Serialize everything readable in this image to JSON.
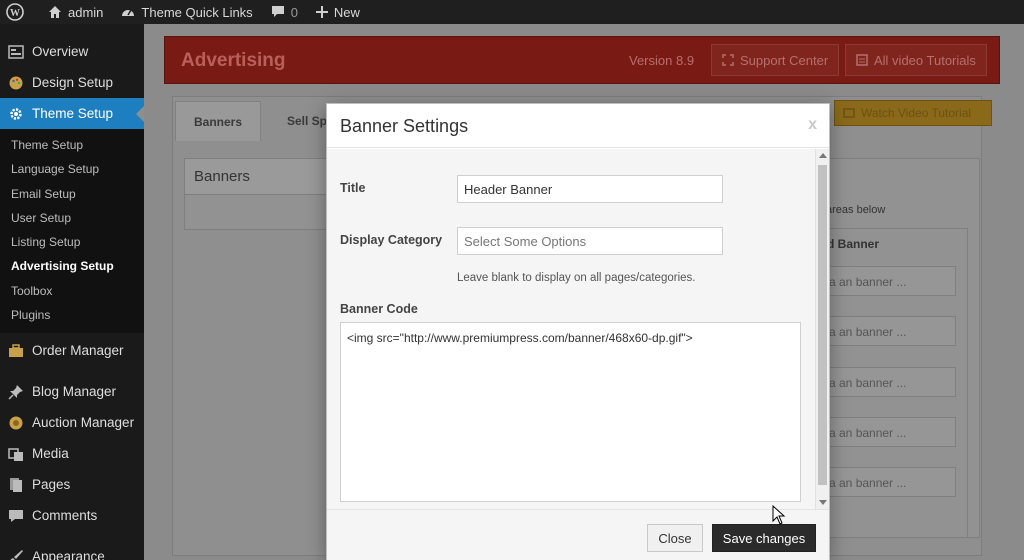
{
  "admin_bar": {
    "site_name": "admin",
    "quick_links": "Theme Quick Links",
    "comments_count": "0",
    "new_label": "New"
  },
  "sidebar": {
    "items": [
      {
        "label": "Overview",
        "icon": "dashboard-icon"
      },
      {
        "label": "Design Setup",
        "icon": "palette-icon"
      },
      {
        "label": "Theme Setup",
        "icon": "gear-icon"
      }
    ],
    "submenu": [
      "Theme Setup",
      "Language Setup",
      "Email Setup",
      "User Setup",
      "Listing Setup",
      "Advertising Setup",
      "Toolbox",
      "Plugins"
    ],
    "lower_items": [
      {
        "label": "Order Manager",
        "icon": "briefcase-icon"
      },
      {
        "label": "Blog Manager",
        "icon": "pin-icon"
      },
      {
        "label": "Auction Manager",
        "icon": "auction-icon"
      },
      {
        "label": "Media",
        "icon": "media-icon"
      },
      {
        "label": "Pages",
        "icon": "pages-icon"
      },
      {
        "label": "Comments",
        "icon": "comment-icon"
      },
      {
        "label": "Appearance",
        "icon": "brush-icon"
      }
    ],
    "active_color": "#1d7fc0"
  },
  "background_page": {
    "title": "Advertising",
    "version": "Version 8.9",
    "support_btn": "Support Center",
    "tutorials_btn": "All video Tutorials",
    "tab_banners": "Banners",
    "tab_second": "Sell Sp",
    "watch_btn": "Watch Video Tutorial",
    "banners_box_title": "Banners",
    "right_note": "areas below",
    "right_col_head": "d Banner",
    "add_banner_label": "a an banner ..."
  },
  "modal": {
    "title": "Banner Settings",
    "close_x": "x",
    "title_label": "Title",
    "title_value": "Header Banner",
    "category_label": "Display Category",
    "category_placeholder": "Select Some Options",
    "category_help": "Leave blank to display on all pages/categories.",
    "code_label": "Banner Code",
    "code_value": "<img src=\"http://www.premiumpress.com/banner/468x60-dp.gif\">",
    "close_button": "Close",
    "save_button": "Save changes"
  }
}
